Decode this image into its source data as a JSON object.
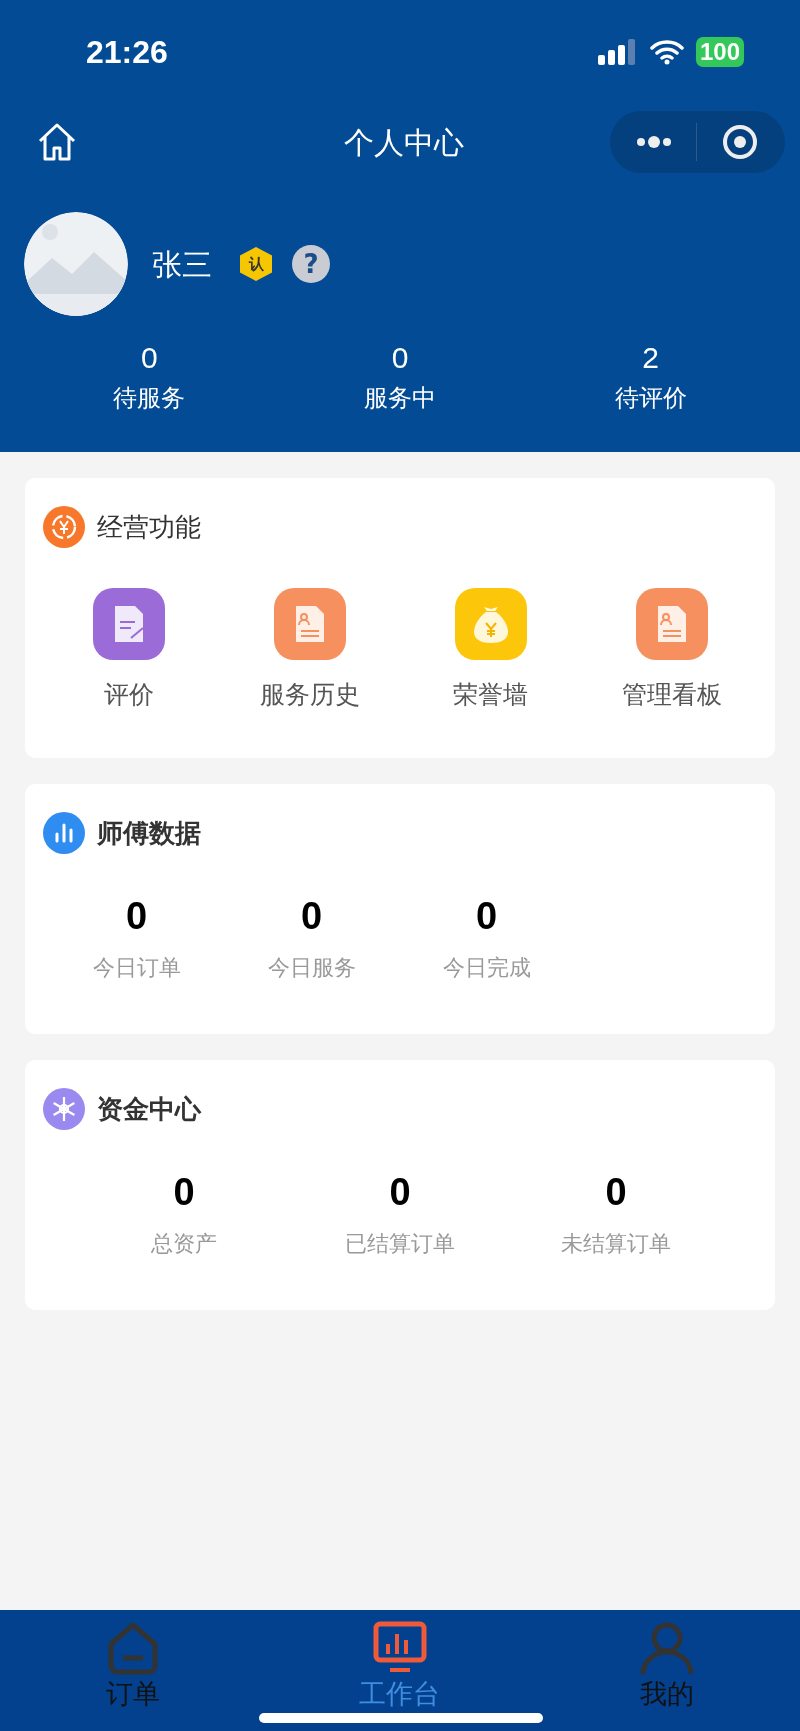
{
  "status_bar": {
    "time": "21:26",
    "battery": "100"
  },
  "nav": {
    "title": "个人中心"
  },
  "profile": {
    "name": "张三",
    "badge": "认",
    "help": "?"
  },
  "stats": [
    {
      "value": "0",
      "label": "待服务"
    },
    {
      "value": "0",
      "label": "服务中"
    },
    {
      "value": "2",
      "label": "待评价"
    }
  ],
  "sections": [
    {
      "kind": "grid",
      "title": "经营功能",
      "items": [
        {
          "label": "评价",
          "color": "#9b6bd8"
        },
        {
          "label": "服务历史",
          "color": "#f6915f"
        },
        {
          "label": "荣誉墙",
          "color": "#fcc60b"
        },
        {
          "label": "管理看板",
          "color": "#f6915f"
        }
      ]
    },
    {
      "kind": "stats",
      "title": "师傅数据",
      "items": [
        {
          "value": "0",
          "label": "今日订单"
        },
        {
          "value": "0",
          "label": "今日服务"
        },
        {
          "value": "0",
          "label": "今日完成"
        }
      ]
    },
    {
      "kind": "stats",
      "title": "资金中心",
      "items": [
        {
          "value": "0",
          "label": "总资产"
        },
        {
          "value": "0",
          "label": "已结算订单"
        },
        {
          "value": "0",
          "label": "未结算订单"
        }
      ]
    }
  ],
  "tabs": [
    {
      "label": "订单",
      "selected": false
    },
    {
      "label": "工作台",
      "selected": true
    },
    {
      "label": "我的",
      "selected": false
    }
  ]
}
